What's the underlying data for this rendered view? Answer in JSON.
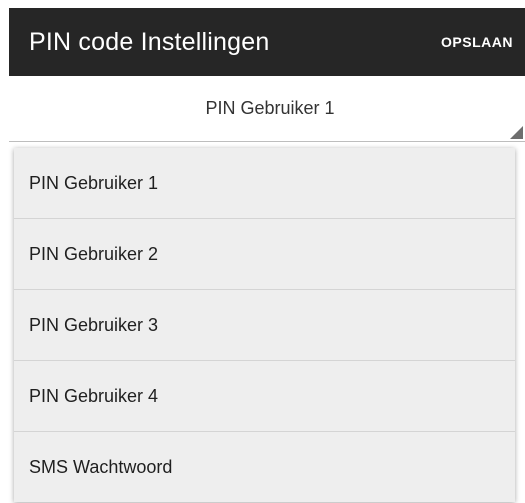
{
  "app_bar": {
    "title": "PIN code Instellingen",
    "save_label": "OPSLAAN"
  },
  "spinner": {
    "selected": "PIN Gebruiker 1"
  },
  "dropdown": {
    "options": [
      "PIN Gebruiker 1",
      "PIN Gebruiker 2",
      "PIN Gebruiker 3",
      "PIN Gebruiker 4",
      "SMS Wachtwoord"
    ]
  },
  "colors": {
    "app_bar_background": "#262626",
    "dropdown_background": "#eeeeee",
    "text_on_dark": "#ffffff"
  }
}
